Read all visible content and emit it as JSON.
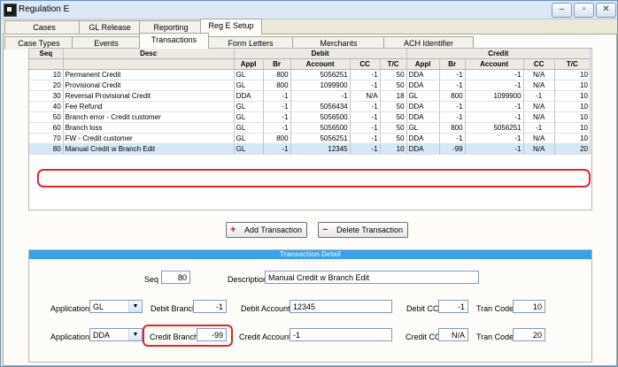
{
  "window": {
    "title": "Regulation E"
  },
  "tabs_top": [
    "Cases",
    "GL Release",
    "Reporting",
    "Reg E Setup"
  ],
  "tabs_sub": [
    "Case Types",
    "Events",
    "Transactions",
    "Form Letters",
    "Merchants",
    "ACH Identifier"
  ],
  "grid": {
    "group_headers": {
      "seq": "Seq",
      "desc": "Desc",
      "debit": "Debit",
      "credit": "Credit"
    },
    "sub_headers": [
      "Appl",
      "Br",
      "Account",
      "CC",
      "T/C",
      "Appl",
      "Br",
      "Account",
      "CC",
      "T/C"
    ],
    "rows": [
      [
        "10",
        "Permanent Credit",
        "GL",
        "800",
        "5056251",
        "-1",
        "50",
        "DDA",
        "-1",
        "-1",
        "N/A",
        "10"
      ],
      [
        "20",
        "Provisional Credit",
        "GL",
        "800",
        "1099900",
        "-1",
        "50",
        "DDA",
        "-1",
        "-1",
        "N/A",
        "10"
      ],
      [
        "30",
        "Reversal Provisional Credit",
        "DDA",
        "-1",
        "-1",
        "N/A",
        "18",
        "GL",
        "800",
        "1099900",
        "-1",
        "10"
      ],
      [
        "40",
        "Fee Refund",
        "GL",
        "-1",
        "5056434",
        "-1",
        "50",
        "DDA",
        "-1",
        "-1",
        "N/A",
        "10"
      ],
      [
        "50",
        "Branch error - Credit customer",
        "GL",
        "-1",
        "5056500",
        "-1",
        "50",
        "DDA",
        "-1",
        "-1",
        "N/A",
        "10"
      ],
      [
        "60",
        "Branch loss",
        "GL",
        "-1",
        "5056500",
        "-1",
        "50",
        "GL",
        "800",
        "5056251",
        "-1",
        "10"
      ],
      [
        "70",
        "FW - Credit customer",
        "GL",
        "800",
        "5056251",
        "-1",
        "50",
        "DDA",
        "-1",
        "-1",
        "N/A",
        "10"
      ],
      [
        "80",
        "Manual Credit w Branch Edit",
        "GL",
        "-1",
        "12345",
        "-1",
        "10",
        "DDA",
        "-99",
        "-1",
        "N/A",
        "20"
      ]
    ]
  },
  "buttons": {
    "add": "Add Transaction",
    "delete": "Delete Transaction"
  },
  "detail": {
    "header": "Transaction Detail",
    "seq_label": "Seq",
    "seq_value": "80",
    "description_label": "Description",
    "description_value": "Manual Credit w Branch Edit",
    "debit_application_label": "Application",
    "debit_application_value": "GL",
    "debit_branch_label": "Debit Branch",
    "debit_branch_value": "-1",
    "debit_account_label": "Debit Account",
    "debit_account_value": "12345",
    "debit_cc_label": "Debit CC",
    "debit_cc_value": "-1",
    "debit_tran_code_label": "Tran Code",
    "debit_tran_code_value": "10",
    "credit_application_label": "Application",
    "credit_application_value": "DDA",
    "credit_branch_label": "Credit Branch",
    "credit_branch_value": "-99",
    "credit_account_label": "Credit Account",
    "credit_account_value": "-1",
    "credit_cc_label": "Credit CC",
    "credit_cc_value": "N/A",
    "credit_tran_code_label": "Tran Code",
    "credit_tran_code_value": "20"
  },
  "colors": {
    "highlight": "#e3262d",
    "detail_header": "#3ba0ea",
    "selected_row": "#d4e8f8"
  }
}
